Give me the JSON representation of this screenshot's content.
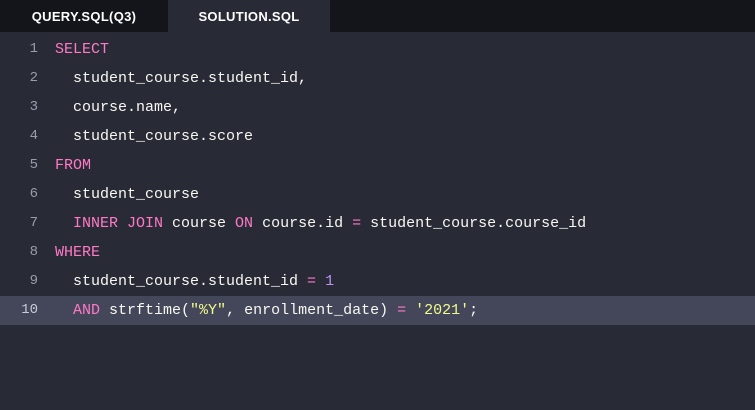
{
  "tabs": [
    {
      "label": "QUERY.SQL(Q3)",
      "active": false
    },
    {
      "label": "SOLUTION.SQL",
      "active": true
    }
  ],
  "editor": {
    "current_line": 10,
    "lines": [
      {
        "num": "1",
        "tokens": [
          {
            "t": "SELECT",
            "c": "kw"
          }
        ]
      },
      {
        "num": "2",
        "tokens": [
          {
            "t": "  student_course.student_id,",
            "c": "plain"
          }
        ]
      },
      {
        "num": "3",
        "tokens": [
          {
            "t": "  course.name,",
            "c": "plain"
          }
        ]
      },
      {
        "num": "4",
        "tokens": [
          {
            "t": "  student_course.score",
            "c": "plain"
          }
        ]
      },
      {
        "num": "5",
        "tokens": [
          {
            "t": "FROM",
            "c": "kw"
          }
        ]
      },
      {
        "num": "6",
        "tokens": [
          {
            "t": "  student_course",
            "c": "plain"
          }
        ]
      },
      {
        "num": "7",
        "tokens": [
          {
            "t": "  ",
            "c": "plain"
          },
          {
            "t": "INNER JOIN",
            "c": "kw"
          },
          {
            "t": " course ",
            "c": "plain"
          },
          {
            "t": "ON",
            "c": "kw"
          },
          {
            "t": " course.id ",
            "c": "plain"
          },
          {
            "t": "=",
            "c": "op"
          },
          {
            "t": " student_course.course_id",
            "c": "plain"
          }
        ]
      },
      {
        "num": "8",
        "tokens": [
          {
            "t": "WHERE",
            "c": "kw"
          }
        ]
      },
      {
        "num": "9",
        "tokens": [
          {
            "t": "  student_course.student_id ",
            "c": "plain"
          },
          {
            "t": "=",
            "c": "op"
          },
          {
            "t": " ",
            "c": "plain"
          },
          {
            "t": "1",
            "c": "num"
          }
        ]
      },
      {
        "num": "10",
        "tokens": [
          {
            "t": "  ",
            "c": "plain"
          },
          {
            "t": "AND",
            "c": "kw"
          },
          {
            "t": " strftime(",
            "c": "plain"
          },
          {
            "t": "\"%Y\"",
            "c": "str"
          },
          {
            "t": ", enrollment_date) ",
            "c": "plain"
          },
          {
            "t": "=",
            "c": "op"
          },
          {
            "t": " ",
            "c": "plain"
          },
          {
            "t": "'2021'",
            "c": "str"
          },
          {
            "t": ";",
            "c": "plain"
          }
        ]
      }
    ]
  },
  "colors": {
    "background": "#282a36",
    "tabbar": "#14151b",
    "current_line": "#44475a",
    "keyword": "#ff79c6",
    "number": "#bd93f9",
    "string": "#f1fa8c",
    "text": "#f8f8f2"
  }
}
